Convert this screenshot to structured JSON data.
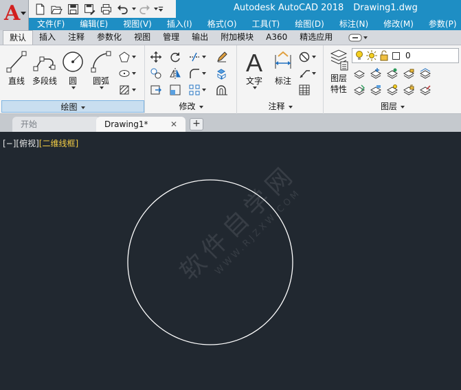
{
  "app": {
    "logo_letter": "A",
    "title": "Autodesk AutoCAD 2018",
    "document": "Drawing1.dwg",
    "accent_color": "#1e8ec4",
    "logo_color": "#d2201f"
  },
  "quick_access": {
    "icons": [
      "new-icon",
      "open-icon",
      "save-icon",
      "save-as-icon",
      "plot-icon",
      "undo-icon",
      "redo-icon",
      "customize-icon"
    ]
  },
  "menu": {
    "items": [
      "文件(F)",
      "编辑(E)",
      "视图(V)",
      "插入(I)",
      "格式(O)",
      "工具(T)",
      "绘图(D)",
      "标注(N)",
      "修改(M)",
      "参数(P)"
    ]
  },
  "ribbon_tabs": {
    "items": [
      "默认",
      "插入",
      "注释",
      "参数化",
      "视图",
      "管理",
      "输出",
      "附加模块",
      "A360",
      "精选应用"
    ],
    "active": "默认"
  },
  "panels": {
    "draw": {
      "title": "绘图",
      "line": "直线",
      "polyline": "多段线",
      "circle": "圆",
      "arc": "圆弧"
    },
    "modify": {
      "title": "修改"
    },
    "annotation": {
      "title": "注释",
      "text": "文字",
      "dimension": "标注"
    },
    "layers": {
      "title": "图层",
      "properties_line1": "图层",
      "properties_line2": "特性",
      "current_layer": "0"
    }
  },
  "file_tabs": {
    "start": "开始",
    "drawing": "Drawing1*",
    "close_glyph": "✕",
    "add_glyph": "+"
  },
  "viewport": {
    "control_minus": "[−]",
    "view": "[俯视]",
    "visual_style": "[二维线框]"
  },
  "watermark": {
    "text": "软件自学网",
    "url": "WWW.RJZXW.COM"
  },
  "colors": {
    "canvas_bg": "#212830",
    "visual_style_text": "#f2cc45",
    "circle_stroke": "#ffffff"
  }
}
